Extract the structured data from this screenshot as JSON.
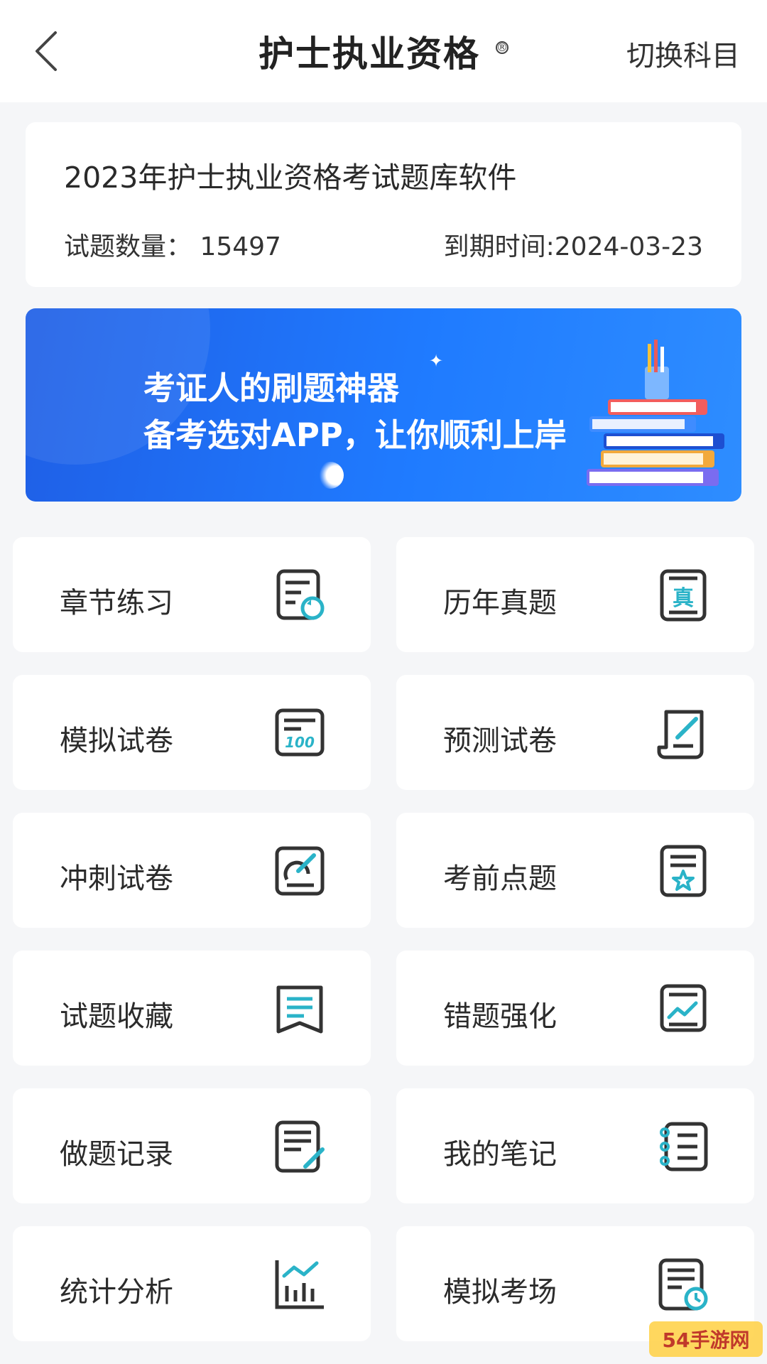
{
  "header": {
    "title": "护士执业资格",
    "title_mark": "®",
    "switch_label": "切换科目"
  },
  "info": {
    "title": "2023年护士执业资格考试题库软件",
    "count_text": "试题数量：  15497",
    "expire_text": "到期时间:2024-03-23"
  },
  "banner": {
    "line1": "考证人的刷题神器",
    "line2": "备考选对APP，让你顺利上岸"
  },
  "tiles": [
    {
      "label": "章节练习",
      "icon": "chapter-practice-icon"
    },
    {
      "label": "历年真题",
      "icon": "past-exams-icon"
    },
    {
      "label": "模拟试卷",
      "icon": "mock-paper-icon"
    },
    {
      "label": "预测试卷",
      "icon": "forecast-paper-icon"
    },
    {
      "label": "冲刺试卷",
      "icon": "sprint-paper-icon"
    },
    {
      "label": "考前点题",
      "icon": "pre-exam-tips-icon"
    },
    {
      "label": "试题收藏",
      "icon": "favorites-icon"
    },
    {
      "label": "错题强化",
      "icon": "mistakes-icon"
    },
    {
      "label": "做题记录",
      "icon": "record-icon"
    },
    {
      "label": "我的笔记",
      "icon": "notes-icon"
    },
    {
      "label": "统计分析",
      "icon": "statistics-icon"
    },
    {
      "label": "模拟考场",
      "icon": "mock-exam-room-icon"
    }
  ],
  "colors": {
    "accent": "#2ab3c8",
    "banner": "#1f6ff0",
    "background": "#f5f6f8"
  },
  "watermark": {
    "text": "54手游网"
  }
}
